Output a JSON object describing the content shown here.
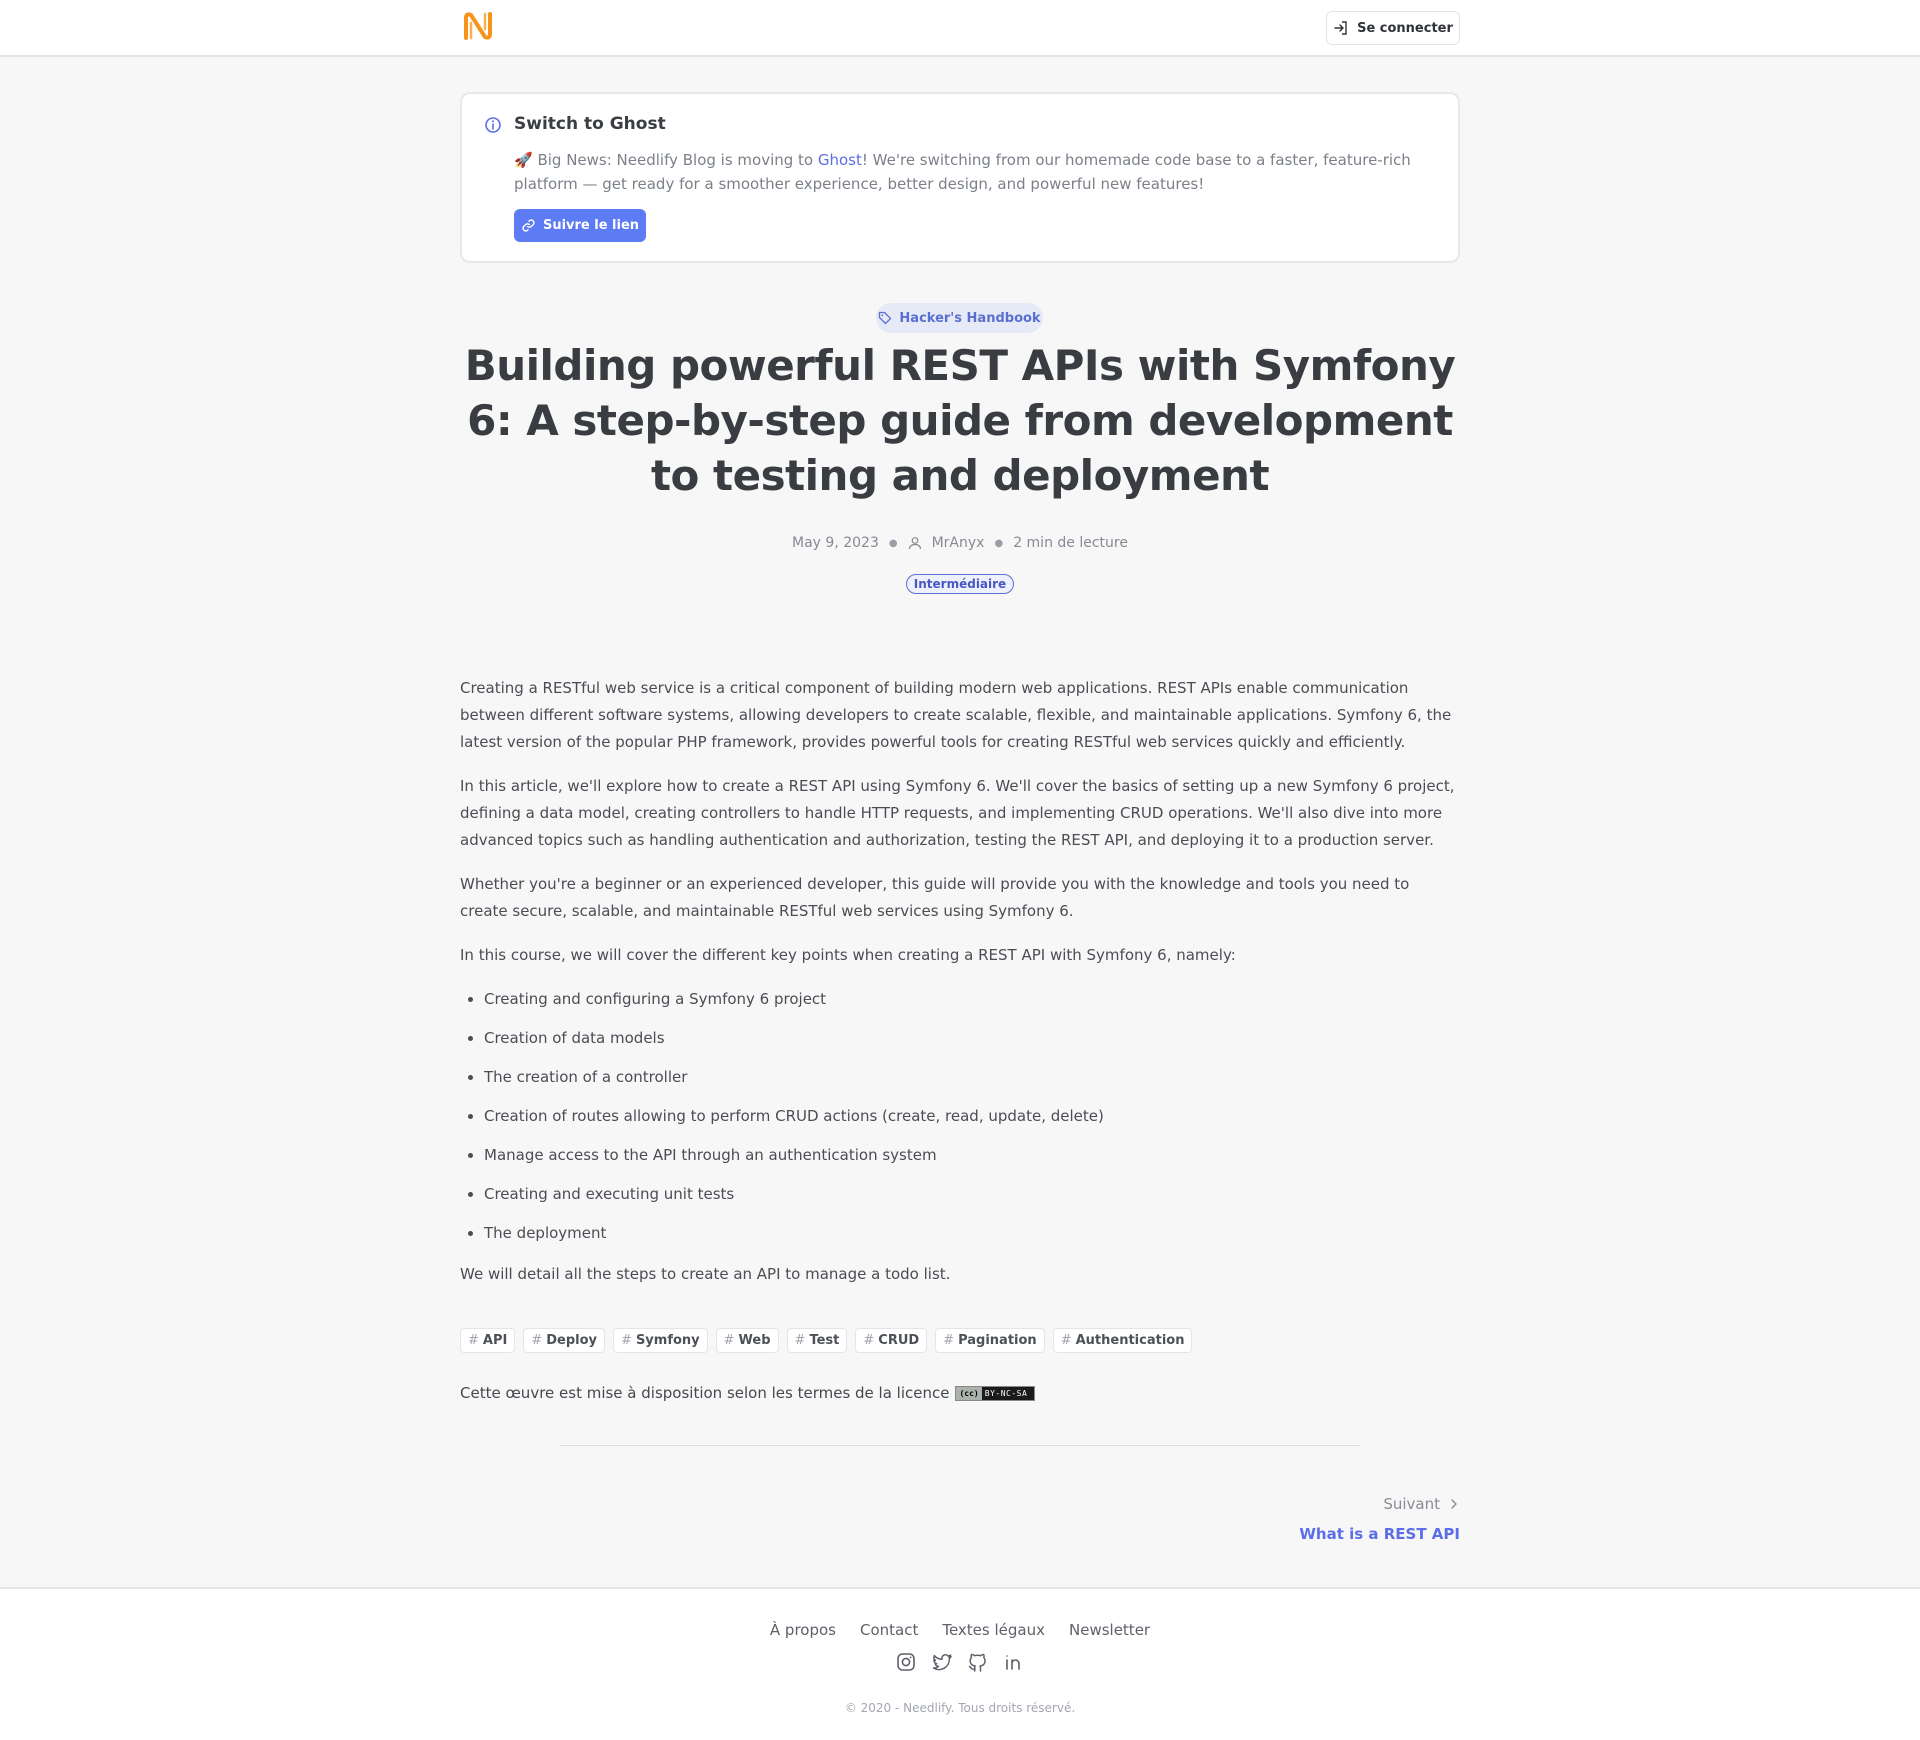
{
  "header": {
    "login_label": "Se connecter"
  },
  "notice": {
    "title": "Switch to Ghost",
    "body_prefix": "🚀 Big News: Needlify Blog is moving to ",
    "body_link": "Ghost",
    "body_suffix": "! We're switching from our homemade code base to a faster, feature-rich platform — get ready for a smoother experience, better design, and powerful new features!",
    "button_label": "Suivre le lien"
  },
  "post": {
    "category": "Hacker's Handbook",
    "title": "Building powerful REST APIs with Symfony 6: A step-by-step guide from development to testing and deployment",
    "date": "May 9, 2023",
    "author": "MrAnyx",
    "reading_time": "2 min de lecture",
    "level": "Intermédiaire",
    "paragraphs": [
      "Creating a RESTful web service is a critical component of building modern web applications. REST APIs enable communication between different software systems, allowing developers to create scalable, flexible, and maintainable applications. Symfony 6, the latest version of the popular PHP framework, provides powerful tools for creating RESTful web services quickly and efficiently.",
      "In this article, we'll explore how to create a REST API using Symfony 6. We'll cover the basics of setting up a new Symfony 6 project, defining a data model, creating controllers to handle HTTP requests, and implementing CRUD operations. We'll also dive into more advanced topics such as handling authentication and authorization, testing the REST API, and deploying it to a production server.",
      "Whether you're a beginner or an experienced developer, this guide will provide you with the knowledge and tools you need to create secure, scalable, and maintainable RESTful web services using Symfony 6.",
      "In this course, we will cover the different key points when creating a REST API with Symfony 6, namely:"
    ],
    "list_items": [
      "Creating and configuring a Symfony 6 project",
      "Creation of data models",
      "The creation of a controller",
      "Creation of routes allowing to perform CRUD actions (create, read, update, delete)",
      "Manage access to the API through an authentication system",
      "Creating and executing unit tests",
      "The deployment"
    ],
    "closing": "We will detail all the steps to create an API to manage a todo list.",
    "tags": [
      "API",
      "Deploy",
      "Symfony",
      "Web",
      "Test",
      "CRUD",
      "Pagination",
      "Authentication"
    ],
    "license_text": "Cette œuvre est mise à disposition selon les termes de la licence",
    "license_badge": "BY-NC-SA",
    "license_badge_cc": "(cc)"
  },
  "navigation": {
    "next_label": "Suivant",
    "next_title": "What is a REST API"
  },
  "footer": {
    "links": [
      "À propos",
      "Contact",
      "Textes légaux",
      "Newsletter"
    ],
    "social_icons": [
      "instagram-icon",
      "twitter-icon",
      "github-icon",
      "linkedin-icon"
    ],
    "copyright": "© 2020 - Needlify. Tous droits réservé."
  },
  "colors": {
    "accent": "#5d7bf2",
    "link": "#5b6ee8",
    "logo": "#f7941d"
  }
}
